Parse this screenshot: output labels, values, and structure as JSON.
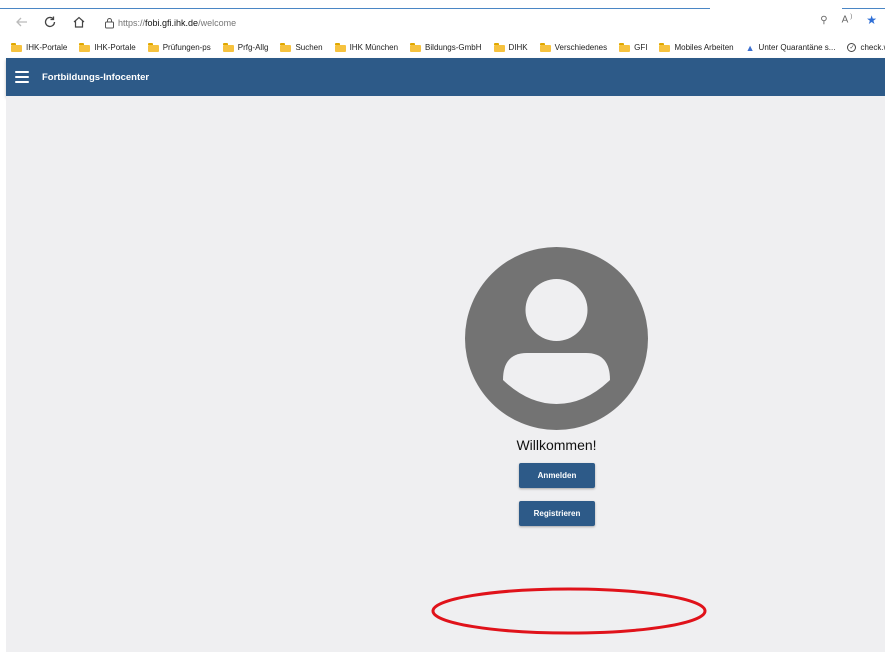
{
  "browser": {
    "url": {
      "protocol": "https://",
      "host": "fobi.gfi.ihk.de",
      "path": "/welcome"
    },
    "bookmarks": [
      {
        "label": "IHK-Portale",
        "icon": "folder-icon"
      },
      {
        "label": "IHK-Portale",
        "icon": "folder-icon"
      },
      {
        "label": "Prüfungen-ps",
        "icon": "folder-icon"
      },
      {
        "label": "Prfg-Allg",
        "icon": "folder-icon"
      },
      {
        "label": "Suchen",
        "icon": "folder-icon"
      },
      {
        "label": "IHK München",
        "icon": "folder-icon"
      },
      {
        "label": "Bildungs-GmbH",
        "icon": "folder-icon"
      },
      {
        "label": "DIHK",
        "icon": "folder-icon"
      },
      {
        "label": "Verschiedenes",
        "icon": "folder-icon"
      },
      {
        "label": "GFI",
        "icon": "folder-icon"
      },
      {
        "label": "Mobiles Arbeiten",
        "icon": "folder-icon"
      },
      {
        "label": "Unter Quarantäne s...",
        "icon": "site-icon"
      },
      {
        "label": "check.work - I",
        "icon": "check-icon"
      }
    ]
  },
  "app": {
    "title": "Fortbildungs-Infocenter"
  },
  "welcome": {
    "greeting": "Willkommen!",
    "login_label": "Anmelden",
    "register_label": "Registrieren"
  },
  "colors": {
    "header": "#2d5a88",
    "button": "#2d5a88",
    "background": "#efeff1",
    "avatar": "#737373",
    "annotation": "#e0121a"
  }
}
